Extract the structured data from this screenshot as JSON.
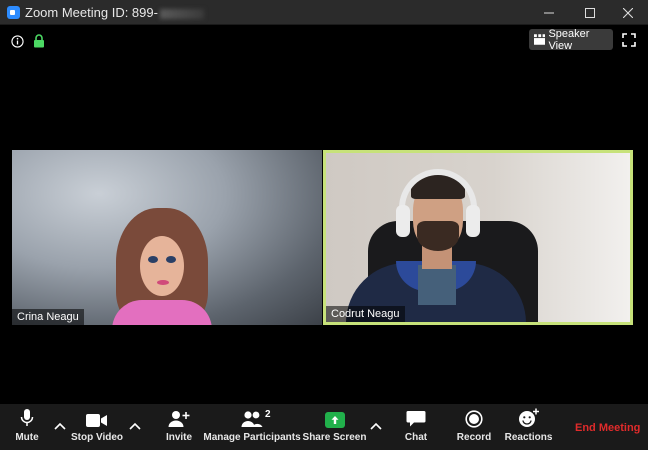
{
  "window": {
    "title_prefix": "Zoom Meeting ID: 899-"
  },
  "top_bar": {
    "speaker_view_label": "Speaker View"
  },
  "participants": [
    {
      "name": "Crina Neagu",
      "active": false
    },
    {
      "name": "Codrut Neagu",
      "active": true
    }
  ],
  "toolbar": {
    "mute_label": "Mute",
    "stop_video_label": "Stop Video",
    "invite_label": "Invite",
    "manage_participants_label": "Manage Participants",
    "participants_count": "2",
    "share_screen_label": "Share Screen",
    "chat_label": "Chat",
    "record_label": "Record",
    "reactions_label": "Reactions",
    "end_meeting_label": "End Meeting"
  },
  "colors": {
    "active_speaker_border": "#c7e27a",
    "share_screen": "#21b04b",
    "end_meeting": "#e02b2b",
    "lock": "#4cd964",
    "zoom_blue": "#2d8cff"
  }
}
